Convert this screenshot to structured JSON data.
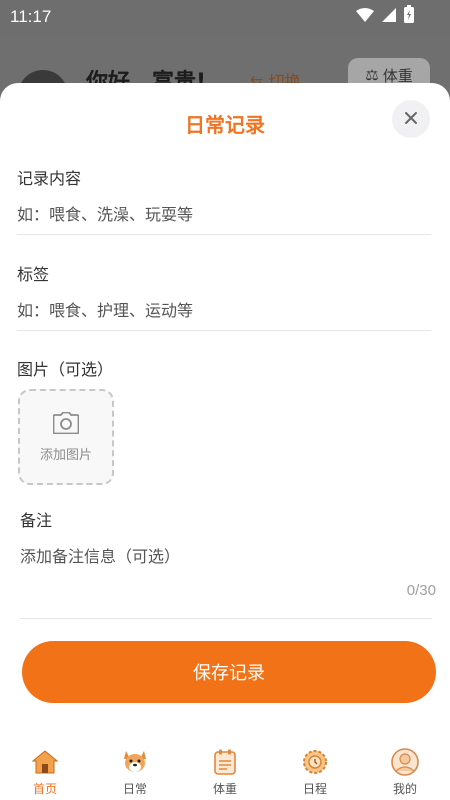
{
  "status_bar": {
    "time": "11:17"
  },
  "background": {
    "greeting": "你好，富贵!",
    "switch_label": "切换",
    "weight_label": "体重"
  },
  "sheet": {
    "title": "日常记录",
    "content_label": "记录内容",
    "content_placeholder": "如：喂食、洗澡、玩耍等",
    "tag_label": "标签",
    "tag_placeholder": "如：喂食、护理、运动等",
    "image_label": "图片（可选）",
    "add_image_label": "添加图片",
    "note_label": "备注",
    "note_placeholder": "添加备注信息（可选）",
    "char_count": "0/30",
    "save_label": "保存记录"
  },
  "nav": {
    "items": [
      {
        "label": "首页",
        "icon": "house-icon"
      },
      {
        "label": "日常",
        "icon": "dog-icon"
      },
      {
        "label": "体重",
        "icon": "scale-icon"
      },
      {
        "label": "日程",
        "icon": "calendar-icon"
      },
      {
        "label": "我的",
        "icon": "profile-icon"
      }
    ],
    "active_index": 0
  },
  "colors": {
    "accent": "#f27218",
    "title": "#f07422"
  }
}
